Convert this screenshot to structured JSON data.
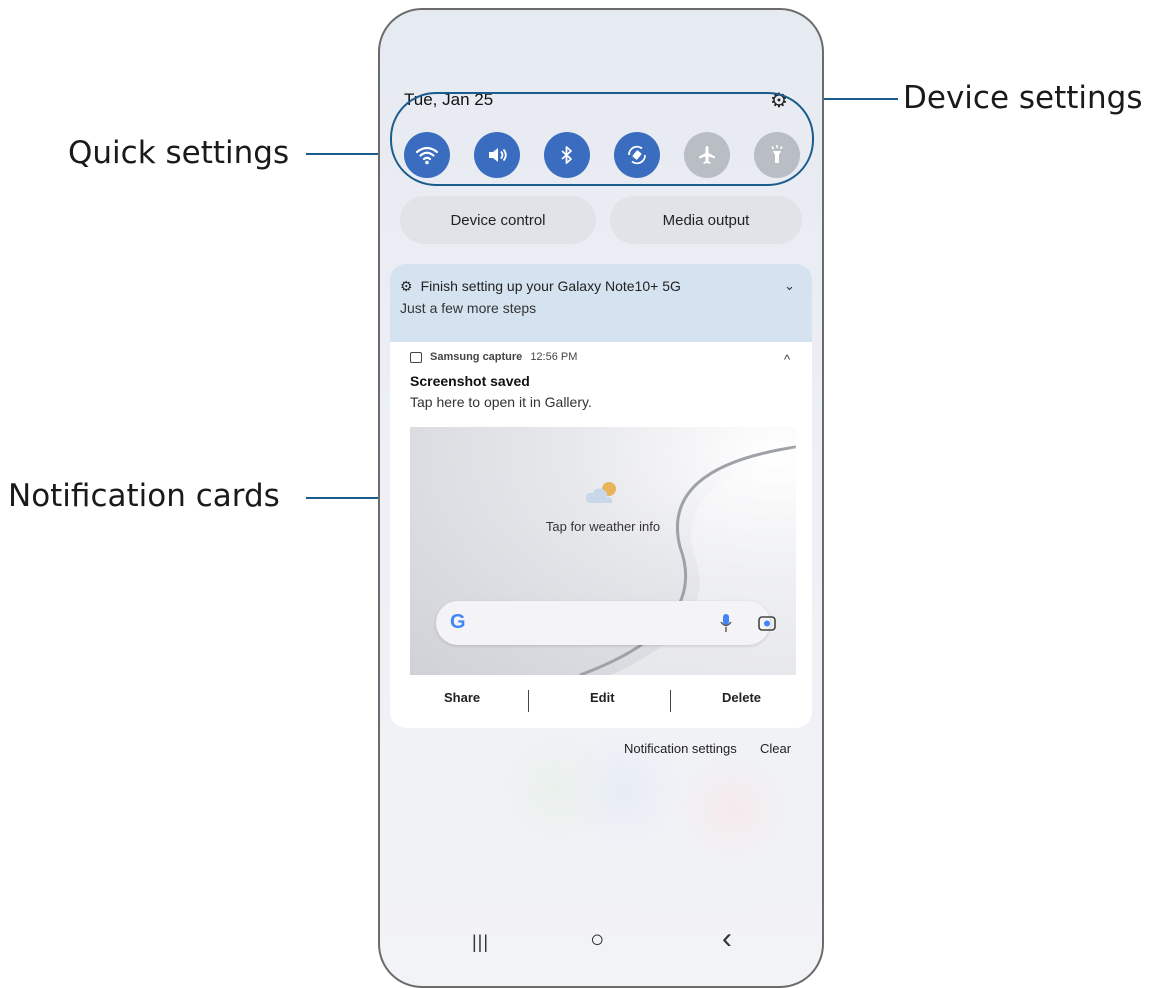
{
  "callouts": {
    "device_settings": "Device settings",
    "quick_settings": "Quick settings",
    "notification_cards": "Notification cards"
  },
  "status": {
    "date": "Tue, Jan 25"
  },
  "quick_settings": [
    {
      "icon": "wifi-icon",
      "state": "on"
    },
    {
      "icon": "sound-icon",
      "state": "on"
    },
    {
      "icon": "bluetooth-icon",
      "state": "on"
    },
    {
      "icon": "auto-rotate-icon",
      "state": "on"
    },
    {
      "icon": "airplane-mode-icon",
      "state": "off"
    },
    {
      "icon": "flashlight-icon",
      "state": "off"
    }
  ],
  "panel_buttons": {
    "device_control": "Device control",
    "media_output": "Media output"
  },
  "setup_card": {
    "title": "Finish setting up your Galaxy Note10+ 5G",
    "subtitle": "Just a few more steps"
  },
  "screenshot_card": {
    "app_name": "Samsung capture",
    "time": "12:56 PM",
    "title": "Screenshot saved",
    "subtitle": "Tap here to open it in Gallery.",
    "preview_weather": "Tap for weather info",
    "google_letter": "G",
    "actions": {
      "share": "Share",
      "edit": "Edit",
      "delete": "Delete"
    }
  },
  "footer": {
    "notification_settings": "Notification settings",
    "clear": "Clear"
  },
  "nav_bar": {
    "recents": "|||",
    "home": "○",
    "back": "‹"
  },
  "colors": {
    "accent": "#1b5c8e",
    "toggle_on": "#3a6cbf",
    "toggle_off": "#b9bdc4",
    "setup_card": "#d5e3f0"
  }
}
